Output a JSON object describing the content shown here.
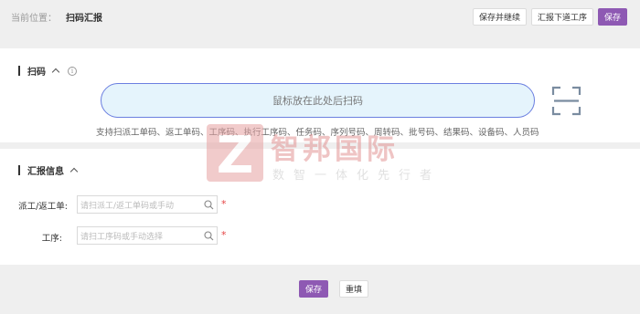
{
  "breadcrumb": {
    "label": "当前位置：",
    "current": "扫码汇报"
  },
  "toolbar": {
    "save_continue": "保存并继续",
    "report_next": "汇报下道工序",
    "save": "保存"
  },
  "scan_section": {
    "title": "扫码",
    "info_icon": "i",
    "scan_box_text": "鼠标放在此处后扫码",
    "tip": "支持扫派工单码、返工单码、工序码、执行工序码、任务码、序列号码、周转码、批号码、结果码、设备码、人员码"
  },
  "report_section": {
    "title": "汇报信息",
    "fields": [
      {
        "label": "派工/返工单:",
        "placeholder": "请扫派工/返工单码或手动",
        "required": "*"
      },
      {
        "label": "工序:",
        "placeholder": "请扫工序码或手动选择",
        "required": "*"
      }
    ]
  },
  "footer": {
    "save": "保存",
    "reset": "重填"
  },
  "watermark": {
    "logo_letter": "Z",
    "name": "智邦国际",
    "slogan": "数智一体化先行者"
  },
  "colors": {
    "primary": "#8e59b3",
    "scan_border": "#6b7fe0",
    "scan_bg": "#e5f4fc",
    "required": "#e54545"
  }
}
